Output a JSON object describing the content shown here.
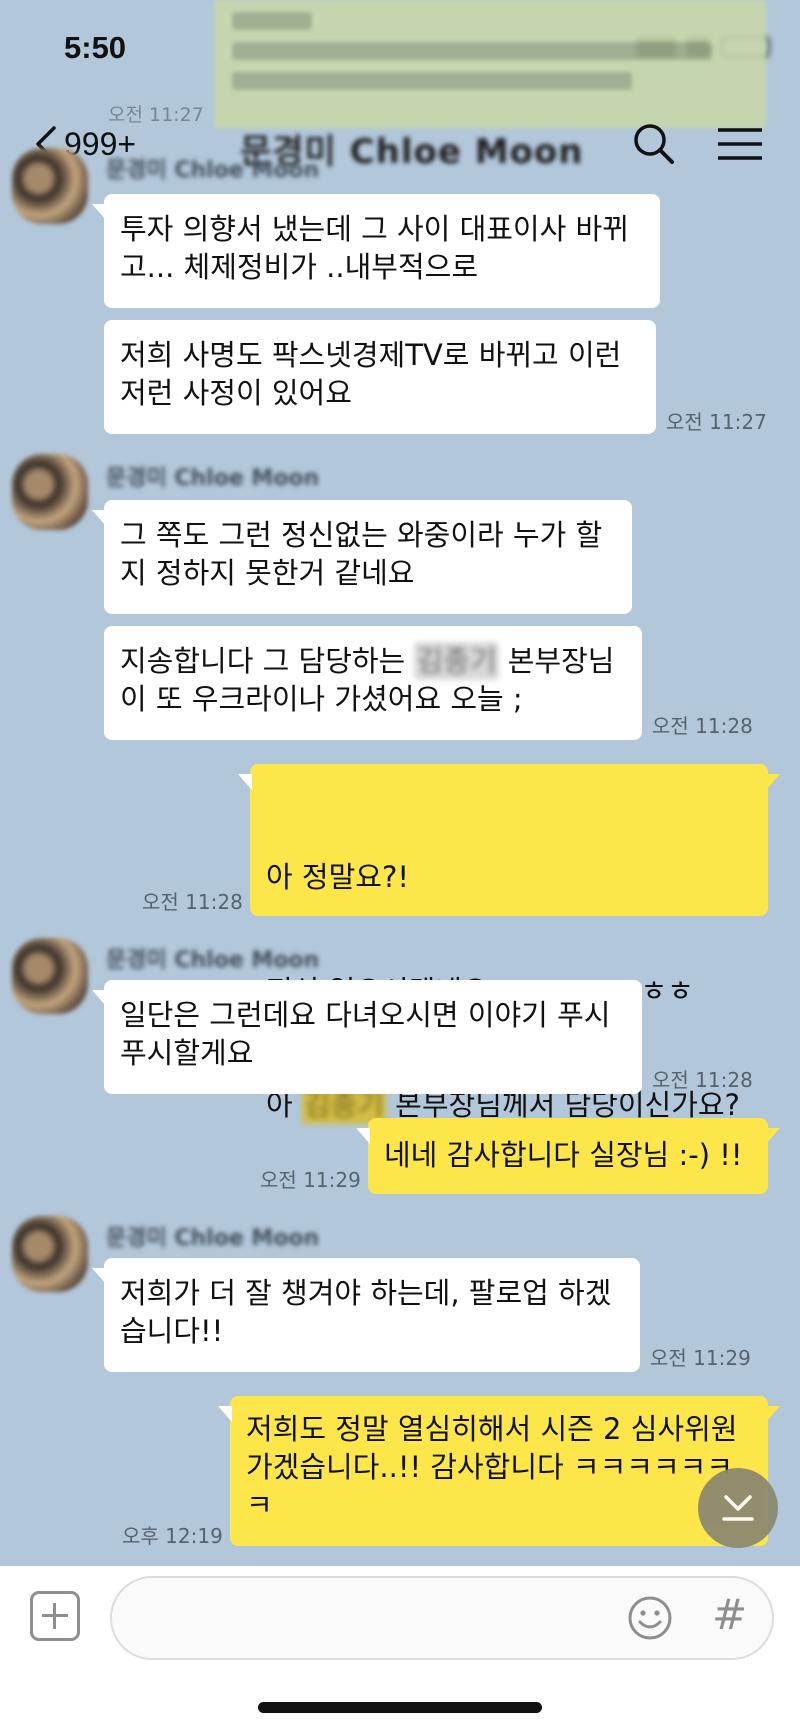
{
  "status_bar": {
    "time": "5:50"
  },
  "header": {
    "back_count": "999+",
    "title": "문경미 Chloe Moon"
  },
  "previous_message_time": "오전 11:27",
  "messages": [
    {
      "sender": "문경미 Chloe Moon",
      "text": "투자 의향서 냈는데 그 사이 대표이사 바뀌\n고... 체제정비가 ..내부적으로"
    },
    {
      "text": "저희 사명도 팍스넷경제TV로 바뀌고 이런\n저런 사정이 있어요",
      "time": "오전 11:27"
    },
    {
      "sender": "문경미 Chloe Moon",
      "text": "그 쪽도 그런 정신없는 와중이라 누가 할\n지 정하지 못한거 같네요"
    },
    {
      "text_before": "지송합니다 그 담당하는 ",
      "redacted": "김종기",
      "text_after": " 본부장님\n이 또 우크라이나 가셨어요 오늘 ;",
      "time": "오전 11:28"
    },
    {
      "line1": "아 정말요?!",
      "line2": "정신 없으시겠네요..ㅎㅎㅎㅎㅎㅎㅎ",
      "line3_before": "아 ",
      "redacted": "김종기",
      "line3_after": " 본부장님께서 담당이신가요?",
      "time": "오전 11:28"
    },
    {
      "sender": "문경미 Chloe Moon",
      "text": "일단은 그런데요 다녀오시면 이야기 푸시\n푸시할게요",
      "time": "오전 11:28"
    },
    {
      "text": "네네 감사합니다 실장님 :-) !!",
      "time": "오전 11:29"
    },
    {
      "sender": "문경미 Chloe Moon",
      "text": "저희가 더 잘 챙겨야 하는데, 팔로업 하겠\n습니다!!",
      "time": "오전 11:29"
    },
    {
      "text": "저희도 정말 열심히해서 시즌 2 심사위원\n가겠습니다..!! 감사합니다 ㅋㅋㅋㅋㅋㅋ\nㅋ",
      "time": "오후 12:19"
    }
  ],
  "input": {
    "placeholder": ""
  },
  "icons": {
    "search": "search-icon",
    "menu": "hamburger-menu-icon",
    "plus": "plus-icon",
    "emoji": "emoji-icon",
    "hash": "#",
    "scroll": "scroll-down-icon"
  },
  "colors": {
    "background": "#b2c7da",
    "my_bubble": "#fce64a",
    "other_bubble": "#ffffff"
  }
}
